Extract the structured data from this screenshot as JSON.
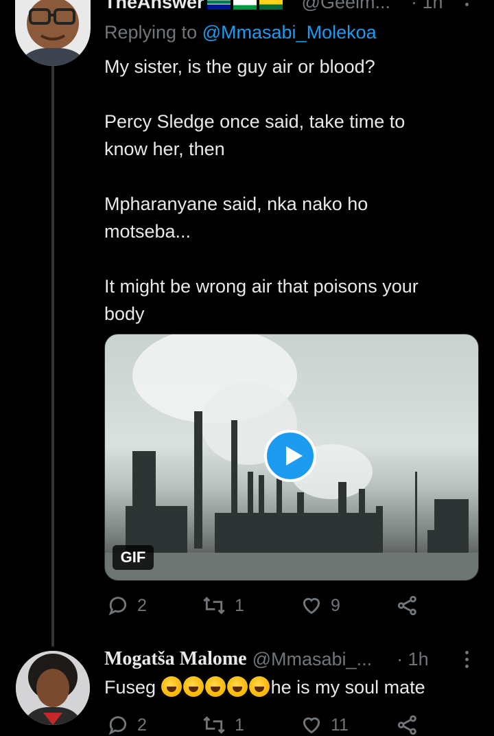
{
  "tweet1": {
    "display_name": "TheAnswer",
    "flags": [
      "za-flag",
      "ls-flag",
      "gh-flag"
    ],
    "handle": "@Geelm...",
    "time": "· 1h",
    "replying_prefix": "Replying to",
    "replying_to": "@Mmasabi_Molekoa",
    "body": "My sister, is the guy air or blood?\n\nPercy Sledge once said, take time to\nknow her, then\n\nMpharanyane said, nka nako ho\nmotseba...\n\nIt might be wrong air that poisons your\nbody",
    "media_badge": "GIF",
    "actions": {
      "replies": "2",
      "retweets": "1",
      "likes": "9"
    }
  },
  "tweet2": {
    "display_name": "Mogatša Malome",
    "handle": "@Mmasabi_...",
    "time": "· 1h",
    "body_prefix": "Fuseg",
    "emoji_count": 5,
    "emoji_name": "rolling-on-the-floor-laughing",
    "body_suffix": "he is my soul mate",
    "actions": {
      "replies": "2",
      "retweets": "1",
      "likes": "11"
    }
  },
  "colors": {
    "background": "#000000",
    "text": "#e7e9ea",
    "muted": "#71767b",
    "accent": "#1d9bf0"
  }
}
